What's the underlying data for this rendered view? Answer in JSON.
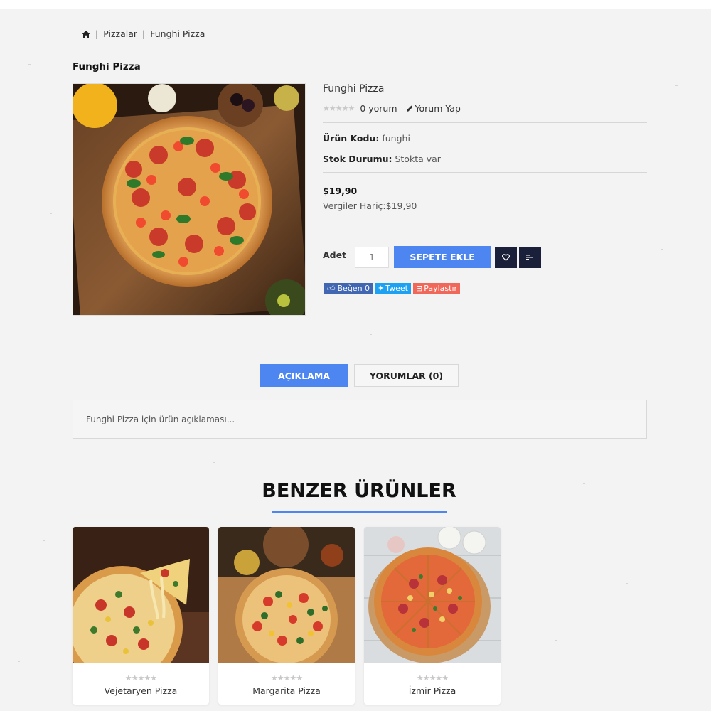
{
  "breadcrumb": {
    "home_icon": "home-icon",
    "items": [
      "Pizzalar",
      "Funghi Pizza"
    ]
  },
  "page_title": "Funghi Pizza",
  "product": {
    "name": "Funghi Pizza",
    "stars": "★★★★★",
    "rating_count": 0,
    "review_count_text": "0 yorum",
    "write_review": "Yorum Yap",
    "code_label": "Ürün Kodu:",
    "code_value": " funghi",
    "stock_label": "Stok Durumu:",
    "stock_value": " Stokta var",
    "price": "$19,90",
    "tax_text": "Vergiler Hariç:$19,90"
  },
  "cart": {
    "qty_label": "Adet",
    "qty_value": "1",
    "add_button": "SEPETE EKLE",
    "wishlist_icon": "heart-icon",
    "compare_icon": "compare-icon"
  },
  "social": {
    "like": "Beğen 0",
    "tweet": "Tweet",
    "share": "Paylaştır"
  },
  "tabs": {
    "description": "AÇIKLAMA",
    "reviews": "YORUMLAR (0)"
  },
  "description_text": "Funghi Pizza için ürün açıklaması...",
  "related": {
    "title": "BENZER ÜRÜNLER",
    "products": [
      {
        "name": "Vejetaryen Pizza",
        "stars": "★★★★★"
      },
      {
        "name": "Margarita Pizza",
        "stars": "★★★★★"
      },
      {
        "name": "İzmir Pizza",
        "stars": "★★★★★"
      }
    ]
  },
  "colors": {
    "accent": "#4d86f0",
    "dark_button": "#1a1f3a",
    "background": "#f3f3f3"
  }
}
